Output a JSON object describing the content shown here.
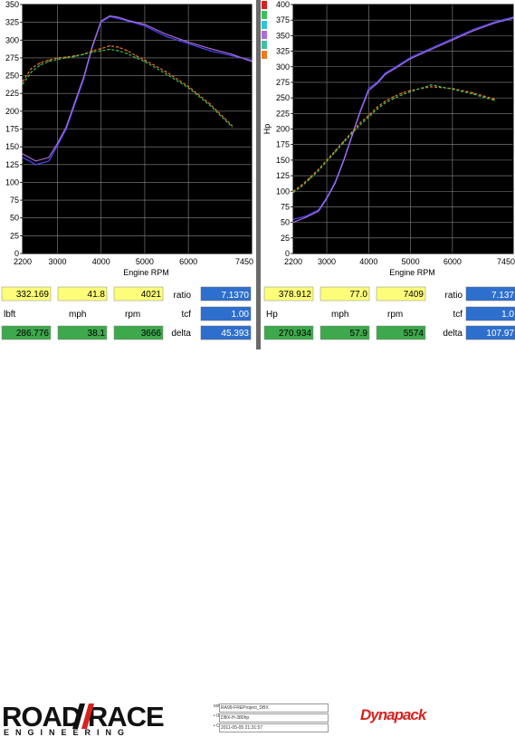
{
  "colors": {
    "plot_bg": "#000000",
    "grid": "#8a8a8a",
    "panel_bg": "#ffffff",
    "yellow_box": "#fdfd7a",
    "green_box": "#3ea84c",
    "blue_box": "#2e6fce",
    "blue_trace": "#4a4aff",
    "purple_trace": "#b06cd8",
    "orange_trace": "#f07a1c",
    "green_trace": "#3cc05a"
  },
  "chart_data": [
    {
      "type": "line",
      "xlabel": "Engine RPM",
      "ylabel": "",
      "xlim": [
        2200,
        7450
      ],
      "ylim": [
        0,
        350
      ],
      "xticks": [
        "2200",
        "3000",
        "4000",
        "5000",
        "6000",
        "7450"
      ],
      "yticks": [
        "0",
        "25",
        "50",
        "75",
        "100",
        "125",
        "150",
        "175",
        "200",
        "225",
        "250",
        "275",
        "300",
        "325",
        "350"
      ],
      "grid": true,
      "series": [
        {
          "color_key": "blue_trace",
          "x": [
            2200,
            2500,
            2800,
            3000,
            3200,
            3400,
            3600,
            3800,
            4000,
            4200,
            4400,
            4600,
            5000,
            5500,
            6000,
            6500,
            7000,
            7450
          ],
          "y": [
            135,
            125,
            130,
            152,
            175,
            210,
            245,
            290,
            325,
            333,
            330,
            327,
            320,
            305,
            295,
            285,
            278,
            272
          ]
        },
        {
          "color_key": "purple_trace",
          "x": [
            2200,
            2500,
            2800,
            3000,
            3200,
            3400,
            3600,
            3800,
            4000,
            4200,
            4400,
            4600,
            5000,
            5500,
            6000,
            6500,
            7000,
            7450
          ],
          "y": [
            140,
            130,
            135,
            155,
            178,
            213,
            248,
            292,
            327,
            334,
            332,
            328,
            322,
            308,
            297,
            288,
            280,
            270
          ]
        },
        {
          "color_key": "orange_trace",
          "x": [
            2200,
            2400,
            2600,
            2800,
            3000,
            3200,
            3400,
            3600,
            3800,
            4000,
            4200,
            4400,
            4600,
            4800,
            5000,
            5500,
            6000,
            6500,
            7000
          ],
          "y": [
            242,
            260,
            268,
            272,
            275,
            276,
            278,
            280,
            285,
            288,
            292,
            290,
            285,
            278,
            272,
            255,
            235,
            210,
            180
          ]
        },
        {
          "color_key": "green_trace",
          "x": [
            2200,
            2400,
            2600,
            2800,
            3000,
            3200,
            3400,
            3600,
            3800,
            4000,
            4200,
            4400,
            4600,
            4800,
            5000,
            5500,
            6000,
            6500,
            7000
          ],
          "y": [
            238,
            255,
            265,
            270,
            273,
            275,
            277,
            280,
            283,
            285,
            287,
            285,
            281,
            275,
            270,
            252,
            233,
            208,
            178
          ]
        }
      ]
    },
    {
      "type": "line",
      "xlabel": "Engine RPM",
      "ylabel": "Hp",
      "xlim": [
        2200,
        7450
      ],
      "ylim": [
        0,
        400
      ],
      "xticks": [
        "2200",
        "3000",
        "4000",
        "5000",
        "6000",
        "7450"
      ],
      "yticks": [
        "0",
        "25",
        "50",
        "75",
        "100",
        "125",
        "150",
        "175",
        "200",
        "225",
        "250",
        "275",
        "300",
        "325",
        "350",
        "375",
        "400"
      ],
      "grid": true,
      "series": [
        {
          "color_key": "blue_trace",
          "x": [
            2200,
            2500,
            2800,
            3000,
            3200,
            3400,
            3600,
            3800,
            4000,
            4200,
            4400,
            4600,
            5000,
            5500,
            6000,
            6500,
            7000,
            7450
          ],
          "y": [
            55,
            60,
            70,
            90,
            115,
            150,
            190,
            230,
            265,
            275,
            290,
            298,
            315,
            330,
            345,
            360,
            372,
            380
          ]
        },
        {
          "color_key": "purple_trace",
          "x": [
            2200,
            2500,
            2800,
            3000,
            3200,
            3400,
            3600,
            3800,
            4000,
            4200,
            4400,
            4600,
            5000,
            5500,
            6000,
            6500,
            7000,
            7450
          ],
          "y": [
            50,
            58,
            68,
            88,
            113,
            148,
            188,
            228,
            262,
            273,
            288,
            296,
            313,
            328,
            343,
            358,
            370,
            378
          ]
        },
        {
          "color_key": "orange_trace",
          "x": [
            2200,
            2400,
            2600,
            2800,
            3000,
            3200,
            3400,
            3600,
            3800,
            4000,
            4200,
            4400,
            4600,
            4800,
            5000,
            5500,
            6000,
            6500,
            7000
          ],
          "y": [
            100,
            110,
            122,
            135,
            150,
            165,
            180,
            195,
            210,
            222,
            235,
            245,
            252,
            258,
            262,
            268,
            265,
            258,
            248
          ]
        },
        {
          "color_key": "green_trace",
          "x": [
            2200,
            2400,
            2600,
            2800,
            3000,
            3200,
            3400,
            3600,
            3800,
            4000,
            4200,
            4400,
            4600,
            4800,
            5000,
            5500,
            6000,
            6500,
            7000
          ],
          "y": [
            98,
            108,
            120,
            133,
            148,
            163,
            178,
            193,
            207,
            219,
            232,
            242,
            249,
            255,
            260,
            271,
            264,
            256,
            246
          ]
        }
      ]
    }
  ],
  "left_panel": {
    "row1": [
      "332.169",
      "41.8",
      "4021"
    ],
    "row2": [
      "lbft",
      "mph",
      "rpm"
    ],
    "row3": [
      "286.776",
      "38.1",
      "3666"
    ],
    "side_labels": [
      "ratio",
      "tcf",
      "delta"
    ],
    "side_values": [
      "7.1370",
      "1.00",
      "45.393"
    ]
  },
  "right_panel": {
    "row1": [
      "378.912",
      "77.0",
      "7409"
    ],
    "row2": [
      "Hp",
      "mph",
      "rpm"
    ],
    "row3": [
      "270.934",
      "57.9",
      "5574"
    ],
    "side_labels": [
      "ratio",
      "tcf",
      "delta"
    ],
    "side_values": [
      "7.137",
      "1.0",
      "107.97"
    ]
  },
  "footer": {
    "logo_text": "ROAD  RACE",
    "logo_sub": "ENGINEERING",
    "info_labels": [
      "est",
      "• ID",
      "• C"
    ],
    "info_values": [
      "RA99-FREProject_DBX",
      "DBX-H-380hp",
      "2011-05-05 21:31:57"
    ],
    "dynapack": "Dynapack"
  }
}
